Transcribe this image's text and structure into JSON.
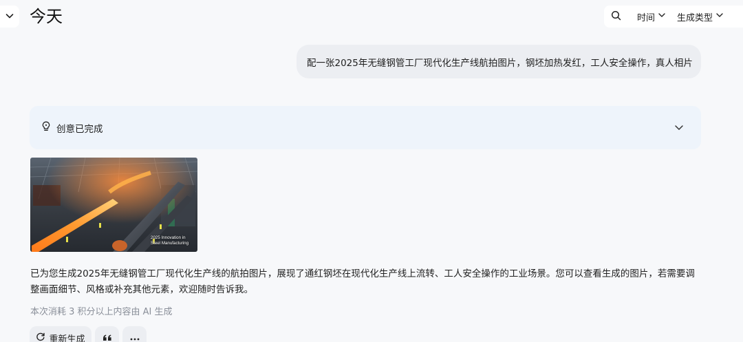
{
  "header": {
    "title": "今天",
    "collapse_icon": "chevron-down-icon",
    "search_icon": "search-icon",
    "filter_time_label": "时间",
    "filter_type_label": "生成类型"
  },
  "conversation": {
    "user_message": "配一张2025年无缝钢管工厂现代化生产线航拍图片，钢坯加热发红，工人安全操作，真人相片",
    "idea_panel": {
      "label": "创意已完成",
      "icon": "lightbulb-icon"
    },
    "generated_image": {
      "caption_line1": "2025 Innovation in",
      "caption_line2": "Steel Manufacturing"
    },
    "assistant_message": "已为您生成2025年无缝钢管工厂现代化生产线的航拍图片，展现了通红钢坯在现代化生产线上流转、工人安全操作的工业场景。您可以查看生成的图片，若需要调整画面细节、风格或补充其他元素，欢迎随时告诉我。",
    "cost_note": "本次消耗 3 积分以上内容由 AI 生成",
    "actions": {
      "regenerate_label": "重新生成",
      "quote_icon": "quote-icon",
      "more_icon": "more-icon"
    }
  },
  "colors": {
    "page_bg": "#f7f8fa",
    "bubble_bg": "#eceef2",
    "idea_panel_bg": "#eef4fb",
    "muted_text": "#8a8f99"
  }
}
